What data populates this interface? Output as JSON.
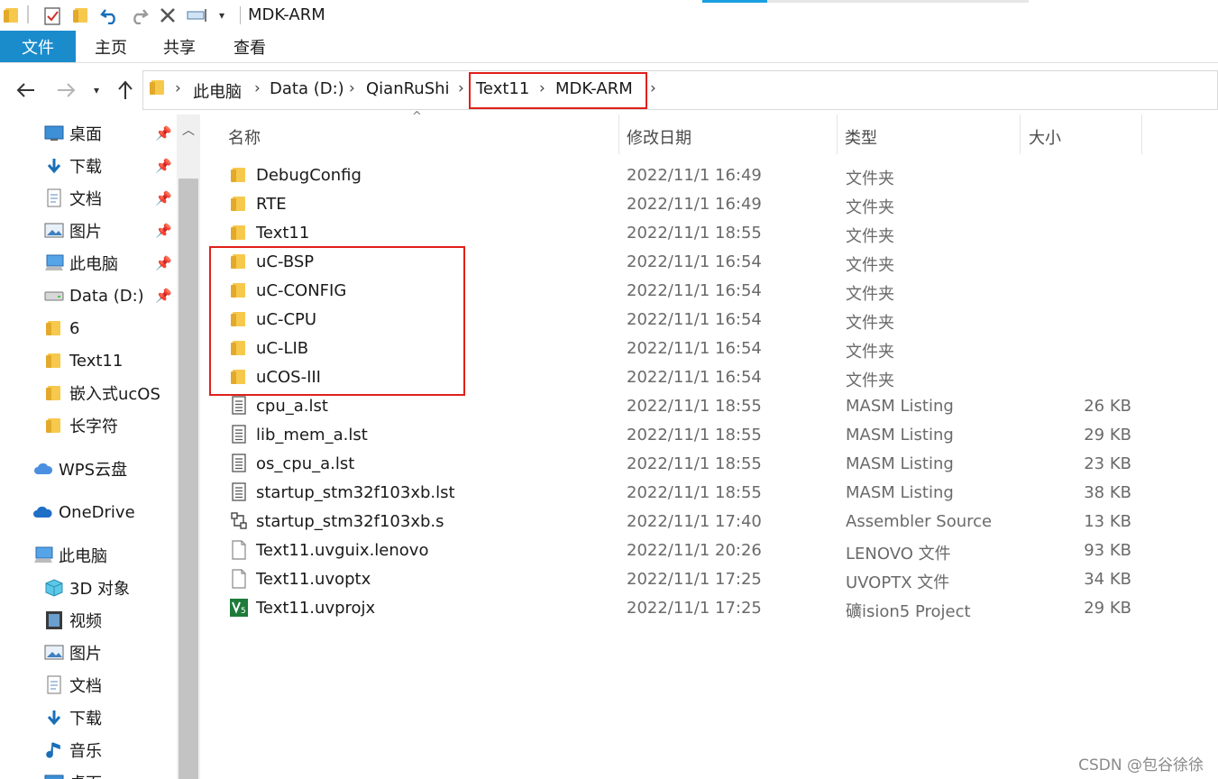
{
  "window": {
    "title": "MDK-ARM"
  },
  "ribbon": {
    "tabs": [
      "文件",
      "主页",
      "共享",
      "查看"
    ]
  },
  "address": {
    "breadcrumbs": [
      "此电脑",
      "Data (D:)",
      "QianRuShi",
      "Text11",
      "MDK-ARM"
    ]
  },
  "sidebar": {
    "items": [
      {
        "label": "桌面",
        "icon": "desktop-icon",
        "pinned": true
      },
      {
        "label": "下载",
        "icon": "download-icon",
        "pinned": true
      },
      {
        "label": "文档",
        "icon": "document-icon",
        "pinned": true
      },
      {
        "label": "图片",
        "icon": "picture-icon",
        "pinned": true
      },
      {
        "label": "此电脑",
        "icon": "computer-icon",
        "pinned": true
      },
      {
        "label": "Data (D:)",
        "icon": "drive-icon",
        "pinned": true
      },
      {
        "label": "6",
        "icon": "folder-icon",
        "pinned": false
      },
      {
        "label": "Text11",
        "icon": "folder-icon",
        "pinned": false
      },
      {
        "label": "嵌入式ucOS",
        "icon": "folder-icon",
        "pinned": false
      },
      {
        "label": "长字符",
        "icon": "folder-icon",
        "pinned": false
      },
      {
        "label": "WPS云盘",
        "icon": "cloud-icon",
        "pinned": false
      },
      {
        "label": "OneDrive",
        "icon": "cloud-icon",
        "pinned": false
      },
      {
        "label": "此电脑",
        "icon": "computer-icon",
        "pinned": false
      },
      {
        "label": "3D 对象",
        "icon": "3d-objects-icon",
        "pinned": false
      },
      {
        "label": "视频",
        "icon": "video-icon",
        "pinned": false
      },
      {
        "label": "图片",
        "icon": "picture-icon",
        "pinned": false
      },
      {
        "label": "文档",
        "icon": "document-icon",
        "pinned": false
      },
      {
        "label": "下载",
        "icon": "download-icon",
        "pinned": false
      },
      {
        "label": "音乐",
        "icon": "music-icon",
        "pinned": false
      },
      {
        "label": "桌面",
        "icon": "desktop-icon",
        "pinned": false
      }
    ]
  },
  "columns": {
    "name": "名称",
    "date": "修改日期",
    "type": "类型",
    "size": "大小"
  },
  "files": [
    {
      "name": "DebugConfig",
      "date": "2022/11/1 16:49",
      "type": "文件夹",
      "size": "",
      "icon": "folder-icon"
    },
    {
      "name": "RTE",
      "date": "2022/11/1 16:49",
      "type": "文件夹",
      "size": "",
      "icon": "folder-icon"
    },
    {
      "name": "Text11",
      "date": "2022/11/1 18:55",
      "type": "文件夹",
      "size": "",
      "icon": "folder-icon"
    },
    {
      "name": "uC-BSP",
      "date": "2022/11/1 16:54",
      "type": "文件夹",
      "size": "",
      "icon": "folder-icon"
    },
    {
      "name": "uC-CONFIG",
      "date": "2022/11/1 16:54",
      "type": "文件夹",
      "size": "",
      "icon": "folder-icon"
    },
    {
      "name": "uC-CPU",
      "date": "2022/11/1 16:54",
      "type": "文件夹",
      "size": "",
      "icon": "folder-icon"
    },
    {
      "name": "uC-LIB",
      "date": "2022/11/1 16:54",
      "type": "文件夹",
      "size": "",
      "icon": "folder-icon"
    },
    {
      "name": "uCOS-III",
      "date": "2022/11/1 16:54",
      "type": "文件夹",
      "size": "",
      "icon": "folder-icon"
    },
    {
      "name": "cpu_a.lst",
      "date": "2022/11/1 18:55",
      "type": "MASM Listing",
      "size": "26 KB",
      "icon": "listing-file-icon"
    },
    {
      "name": "lib_mem_a.lst",
      "date": "2022/11/1 18:55",
      "type": "MASM Listing",
      "size": "29 KB",
      "icon": "listing-file-icon"
    },
    {
      "name": "os_cpu_a.lst",
      "date": "2022/11/1 18:55",
      "type": "MASM Listing",
      "size": "23 KB",
      "icon": "listing-file-icon"
    },
    {
      "name": "startup_stm32f103xb.lst",
      "date": "2022/11/1 18:55",
      "type": "MASM Listing",
      "size": "38 KB",
      "icon": "listing-file-icon"
    },
    {
      "name": "startup_stm32f103xb.s",
      "date": "2022/11/1 17:40",
      "type": "Assembler Source",
      "size": "13 KB",
      "icon": "assembler-file-icon"
    },
    {
      "name": "Text11.uvguix.lenovo",
      "date": "2022/11/1 20:26",
      "type": "LENOVO 文件",
      "size": "93 KB",
      "icon": "blank-file-icon"
    },
    {
      "name": "Text11.uvoptx",
      "date": "2022/11/1 17:25",
      "type": "UVOPTX 文件",
      "size": "34 KB",
      "icon": "blank-file-icon"
    },
    {
      "name": "Text11.uvprojx",
      "date": "2022/11/1 17:25",
      "type": "礦ision5 Project",
      "size": "29 KB",
      "icon": "uvision-project-icon"
    }
  ],
  "watermark": "CSDN @包谷徐徐",
  "colors": {
    "accent": "#1a8ccc",
    "highlight": "#e0201a",
    "folder": "#f6c94d"
  }
}
